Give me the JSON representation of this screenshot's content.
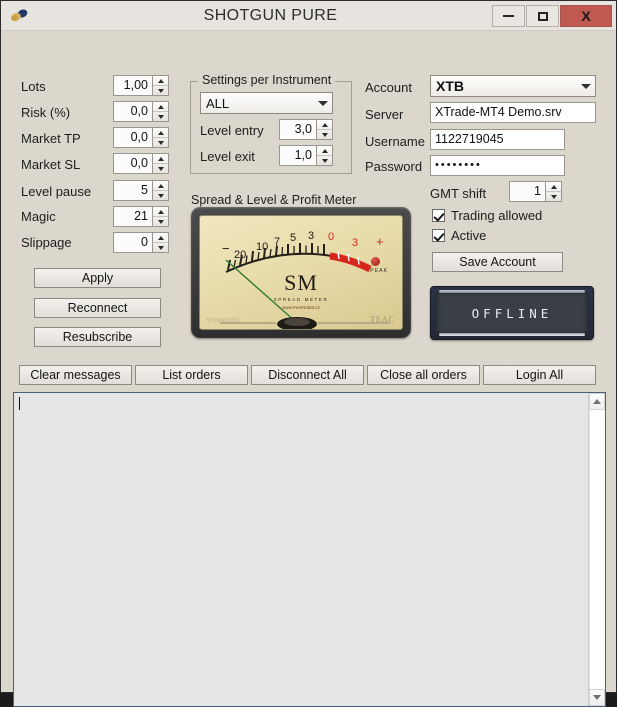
{
  "window": {
    "title": "SHOTGUN PURE",
    "icon": "shotgun-shell-icon",
    "minimize_label": "",
    "maximize_label": "",
    "close_label": "X"
  },
  "params": {
    "fields": [
      {
        "label": "Lots",
        "value": "1,00"
      },
      {
        "label": "Risk (%)",
        "value": "0,0"
      },
      {
        "label": "Market TP",
        "value": "0,0"
      },
      {
        "label": "Market SL",
        "value": "0,0"
      },
      {
        "label": "Level pause",
        "value": "5"
      },
      {
        "label": "Magic",
        "value": "21"
      },
      {
        "label": "Slippage",
        "value": "0"
      }
    ]
  },
  "actions": {
    "apply": "Apply",
    "reconnect": "Reconnect",
    "resubscribe": "Resubscribe"
  },
  "settings_group": {
    "title": "Settings per Instrument",
    "instrument": "ALL",
    "level_entry_label": "Level entry",
    "level_entry_value": "3,0",
    "level_exit_label": "Level exit",
    "level_exit_value": "1,0"
  },
  "meter": {
    "title": "Spread & Level & Profit Meter",
    "brand": "SM",
    "brand_sub": "SPREAD METER",
    "brand_url": "www.ForeRobot.cz",
    "peak_label": "PEAK",
    "maker": "TEAC",
    "model": "5706606001",
    "scale_labels": [
      "−",
      "20",
      "10",
      "7",
      "5",
      "3",
      "0",
      "3",
      "+"
    ],
    "needle_value": "-20",
    "red_zone_from": "0",
    "red_zone_to": "+"
  },
  "account": {
    "account_label": "Account",
    "account_value": "XTB",
    "server_label": "Server",
    "server_value": "XTrade-MT4 Demo.srv",
    "username_label": "Username",
    "username_value": "1122719045",
    "password_label": "Password",
    "password_value": "••••••••",
    "gmt_label": "GMT shift",
    "gmt_value": "1",
    "trading_allowed_label": "Trading allowed",
    "active_label": "Active",
    "save_label": "Save Account",
    "status": "OFFLINE"
  },
  "toolbar": {
    "clear_messages": "Clear messages",
    "list_orders": "List orders",
    "disconnect_all": "Disconnect All",
    "close_all_orders": "Close all orders",
    "login_all": "Login All"
  },
  "log": {
    "content": ""
  },
  "colors": {
    "window_bg": "#dcd7cd",
    "titlebar_bg": "#e7e4df",
    "close_btn": "#c05a51",
    "meter_face": "#e8dcab",
    "meter_red": "#d7271c",
    "needle_green": "#2f7d2f",
    "lcd_bg": "#3a3f46",
    "log_border": "#4a6079"
  }
}
